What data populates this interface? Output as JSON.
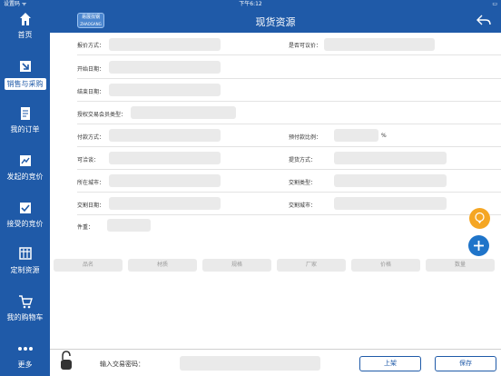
{
  "status": {
    "carrier": "设置码 ᯤ",
    "time": "下午6:12",
    "battery": "▭"
  },
  "sidebar": {
    "items": [
      {
        "label": "首页"
      },
      {
        "label": "销售与采购"
      },
      {
        "label": "我的订单"
      },
      {
        "label": "发起的竞价"
      },
      {
        "label": "接受的竞价"
      },
      {
        "label": "定制资源"
      },
      {
        "label": "我的购物车"
      },
      {
        "label": "更多"
      }
    ]
  },
  "header": {
    "title": "现货资源",
    "logo_text": "易展找钢",
    "logo_sub": "ZHAOGANG"
  },
  "form": {
    "quote_method": {
      "label": "报价方式：",
      "value": ""
    },
    "negotiable": {
      "label": "是否可议价：",
      "value": ""
    },
    "start_date": {
      "label": "开始日期：",
      "value": ""
    },
    "end_date": {
      "label": "结束日期：",
      "value": ""
    },
    "member_type": {
      "label": "授权交易会员类型：",
      "value": ""
    },
    "payment_method": {
      "label": "付款方式：",
      "value": ""
    },
    "prepay_ratio": {
      "label": "预付款比例：",
      "value": "",
      "unit": "%"
    },
    "negotiable_talk": {
      "label": "可洽谈：",
      "value": ""
    },
    "pickup_method": {
      "label": "提货方式：",
      "value": ""
    },
    "city": {
      "label": "所在城市：",
      "value": ""
    },
    "delivery_type": {
      "label": "交割类型：",
      "value": ""
    },
    "delivery_date": {
      "label": "交割日期：",
      "value": ""
    },
    "delivery_city": {
      "label": "交割城市：",
      "value": ""
    },
    "pieces": {
      "label": "件重：",
      "value": ""
    }
  },
  "columns": [
    "品名",
    "材质",
    "规格",
    "厂家",
    "价格",
    "数量"
  ],
  "bottom": {
    "password_label": "输入交易密码：",
    "password_value": "",
    "list_button": "上架",
    "save_button": "保存"
  },
  "colors": {
    "primary": "#1f5aa8",
    "fab_orange": "#f5a623",
    "fab_blue": "#1f74c9"
  }
}
